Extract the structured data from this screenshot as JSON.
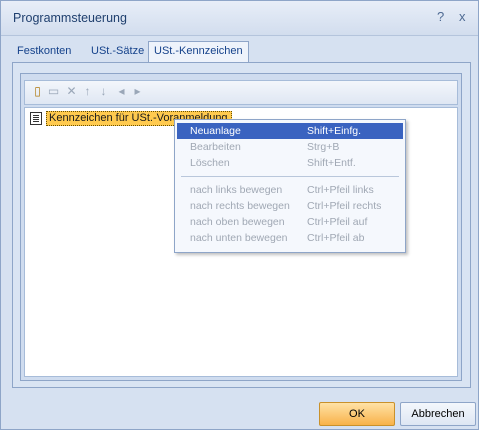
{
  "window": {
    "title": "Programmsteuerung",
    "help": "?",
    "close": "x"
  },
  "tabs": [
    {
      "label": "Festkonten"
    },
    {
      "label": "USt.-Sätze"
    },
    {
      "label": "USt.-Kennzeichen"
    }
  ],
  "toolbar": {
    "icons": [
      "new-icon",
      "edit-icon",
      "delete-icon",
      "arrow-up-icon",
      "arrow-down-icon",
      "arrow-left-icon",
      "arrow-right-icon"
    ]
  },
  "tree": {
    "node_label": "Kennzeichen für USt.-Voranmeldung"
  },
  "context_menu": {
    "items": [
      {
        "label": "Neuanlage",
        "shortcut": "Shift+Einfg."
      },
      {
        "label": "Bearbeiten",
        "shortcut": "Strg+B"
      },
      {
        "label": "Löschen",
        "shortcut": "Shift+Entf."
      },
      {
        "label": "nach links bewegen",
        "shortcut": "Ctrl+Pfeil links"
      },
      {
        "label": "nach rechts bewegen",
        "shortcut": "Ctrl+Pfeil rechts"
      },
      {
        "label": "nach oben bewegen",
        "shortcut": "Ctrl+Pfeil auf"
      },
      {
        "label": "nach unten bewegen",
        "shortcut": "Ctrl+Pfeil ab"
      }
    ]
  },
  "buttons": {
    "ok": "OK",
    "cancel": "Abbrechen"
  },
  "colors": {
    "selection": "#3a63c0",
    "ok_button": "#f8b24a",
    "node_highlight": "#ffca4f"
  }
}
